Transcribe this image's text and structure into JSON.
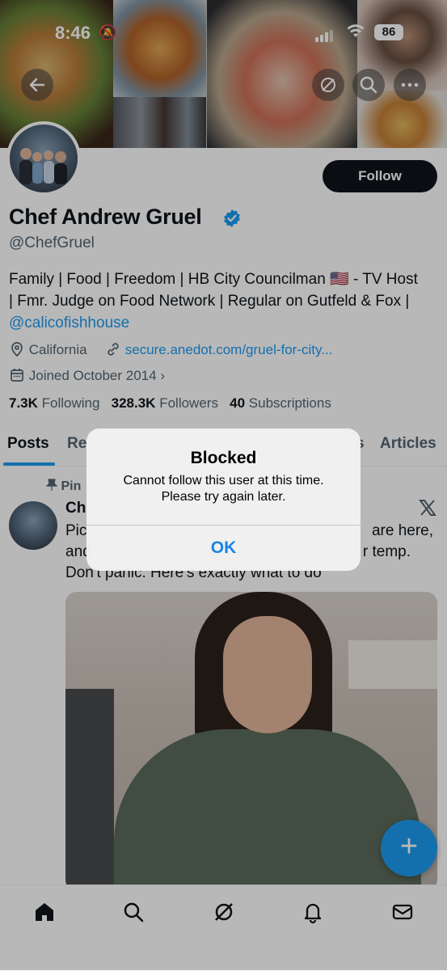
{
  "status_bar": {
    "time": "8:46",
    "battery": "86"
  },
  "profile": {
    "name": "Chef Andrew Gruel",
    "handle": "@ChefGruel",
    "bio_line1": "Family | Food | Freedom | HB City Councilman 🇺🇸 - TV Host",
    "bio_line2": "| Fmr. Judge on Food Network | Regular on Gutfeld & Fox |",
    "bio_link": "@calicofishhouse",
    "location": "California",
    "website": "secure.anedot.com/gruel-for-city...",
    "joined": "Joined October 2014",
    "following_count": "7.3K",
    "following_label": "Following",
    "followers_count": "328.3K",
    "followers_label": "Followers",
    "subscriptions_count": "40",
    "subscriptions_label": "Subscriptions",
    "follow_label": "Follow"
  },
  "tabs": [
    {
      "label": "Posts"
    },
    {
      "label": "Re"
    },
    {
      "label": "s"
    },
    {
      "label": "Articles"
    }
  ],
  "post": {
    "pinned_label": "Pin",
    "author_partial": "Ch",
    "line1_left": "Pic",
    "line1_right": "are here,",
    "line2_left": "and",
    "line2_right": "r temp.",
    "line3": "Don't panic. Here's exactly what to do"
  },
  "alert": {
    "title": "Blocked",
    "message": "Cannot follow this user at this time. Please try again later.",
    "ok_label": "OK"
  },
  "fab_label": "+",
  "nav": [
    "home-icon",
    "search-icon",
    "grok-icon",
    "notifications-icon",
    "messages-icon"
  ],
  "colors": {
    "accent": "#1d9bf0",
    "dark": "#0f1419",
    "muted": "#536471"
  }
}
